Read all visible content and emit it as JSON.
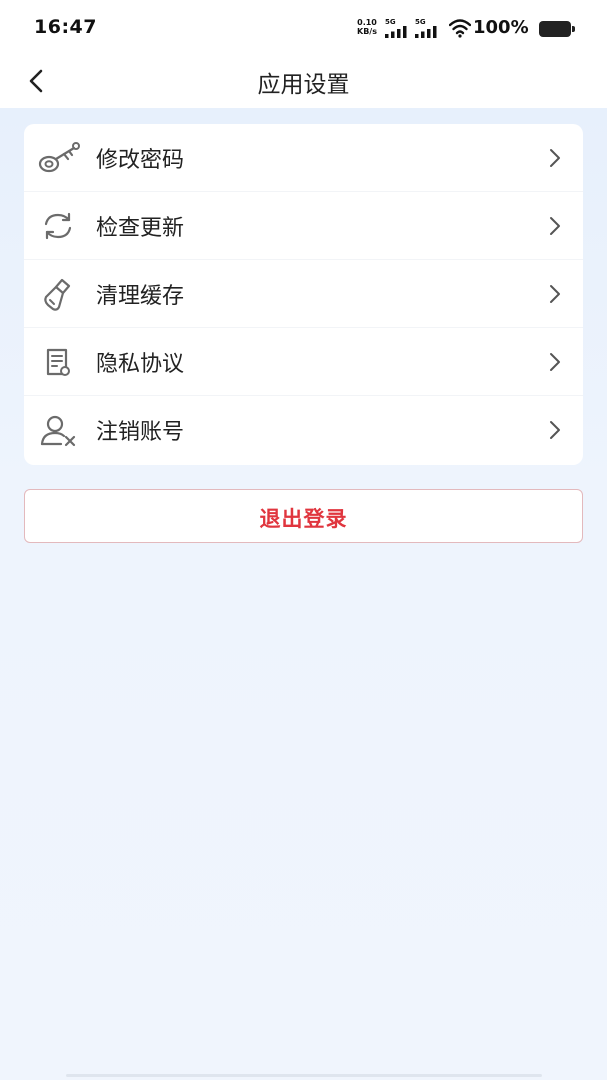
{
  "status_bar": {
    "time": "16:47",
    "net_speed_value": "0.10",
    "net_speed_unit": "KB/s",
    "signal_1_label": "5G",
    "signal_2_label": "5G",
    "battery_text": "100%"
  },
  "nav": {
    "title": "应用设置",
    "back_icon": "chevron-left-icon"
  },
  "menu": {
    "items": [
      {
        "label": "修改密码",
        "icon": "key-icon"
      },
      {
        "label": "检查更新",
        "icon": "refresh-icon"
      },
      {
        "label": "清理缓存",
        "icon": "broom-icon"
      },
      {
        "label": "隐私协议",
        "icon": "document-icon"
      },
      {
        "label": "注销账号",
        "icon": "user-remove-icon"
      }
    ]
  },
  "logout": {
    "label": "退出登录"
  },
  "colors": {
    "accent_red": "#e0353e",
    "background": "#eef4fd",
    "card": "#ffffff",
    "icon_gray": "#6b6b6b"
  }
}
